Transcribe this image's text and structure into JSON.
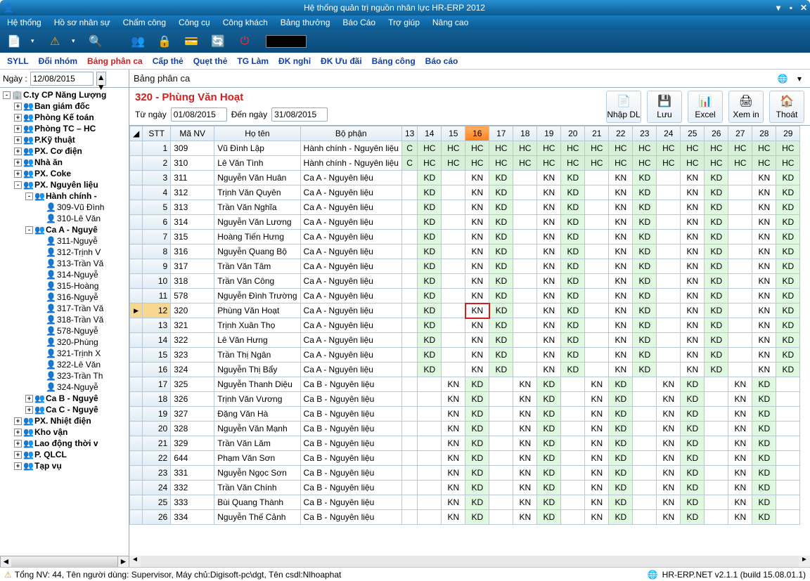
{
  "window": {
    "title": "Hệ thống quản trị nguồn nhân lực HR-ERP 2012"
  },
  "menu": [
    "Hệ thống",
    "Hồ sơ nhân sự",
    "Chấm công",
    "Công cụ",
    "Công khách",
    "Bảng thưởng",
    "Báo Cáo",
    "Trợ giúp",
    "Nâng cao"
  ],
  "tabs": [
    "SYLL",
    "Đổi nhóm",
    "Bảng phân ca",
    "Cấp thẻ",
    "Quẹt thẻ",
    "TG Làm",
    "ĐK nghỉ",
    "ĐK Ưu đãi",
    "Bảng công",
    "Báo cáo"
  ],
  "tabs_active_index": 2,
  "left": {
    "date_label": "Ngày :",
    "date_value": "12/08/2015",
    "tree": [
      {
        "ind": 0,
        "exp": "-",
        "bold": true,
        "ico": "🏢",
        "label": "C.ty CP Năng Lượng"
      },
      {
        "ind": 1,
        "exp": "+",
        "bold": true,
        "ico": "👥",
        "label": "Ban giám đốc"
      },
      {
        "ind": 1,
        "exp": "+",
        "bold": true,
        "ico": "👥",
        "label": "Phòng Kế toán"
      },
      {
        "ind": 1,
        "exp": "+",
        "bold": true,
        "ico": "👥",
        "label": "Phòng TC – HC"
      },
      {
        "ind": 1,
        "exp": "+",
        "bold": true,
        "ico": "👥",
        "label": "P.Kỹ thuật"
      },
      {
        "ind": 1,
        "exp": "+",
        "bold": true,
        "ico": "👥",
        "label": "PX. Cơ điện"
      },
      {
        "ind": 1,
        "exp": "+",
        "bold": true,
        "ico": "👥",
        "label": "Nhà ăn"
      },
      {
        "ind": 1,
        "exp": "+",
        "bold": true,
        "ico": "👥",
        "label": "PX. Coke"
      },
      {
        "ind": 1,
        "exp": "-",
        "bold": true,
        "ico": "👥",
        "label": "PX. Nguyên liệu"
      },
      {
        "ind": 2,
        "exp": "-",
        "bold": true,
        "ico": "👥",
        "label": "Hành chính -"
      },
      {
        "ind": 3,
        "exp": "",
        "bold": false,
        "ico": "👤",
        "label": "309-Vũ Đình"
      },
      {
        "ind": 3,
        "exp": "",
        "bold": false,
        "ico": "👤",
        "label": "310-Lê Văn"
      },
      {
        "ind": 2,
        "exp": "-",
        "bold": true,
        "ico": "👥",
        "label": "Ca A - Nguyê"
      },
      {
        "ind": 3,
        "exp": "",
        "bold": false,
        "ico": "👤",
        "label": "311-Nguyễ"
      },
      {
        "ind": 3,
        "exp": "",
        "bold": false,
        "ico": "👤",
        "label": "312-Trịnh V"
      },
      {
        "ind": 3,
        "exp": "",
        "bold": false,
        "ico": "👤",
        "label": "313-Trần Vă"
      },
      {
        "ind": 3,
        "exp": "",
        "bold": false,
        "ico": "👤",
        "label": "314-Nguyễ"
      },
      {
        "ind": 3,
        "exp": "",
        "bold": false,
        "ico": "👤",
        "label": "315-Hoàng"
      },
      {
        "ind": 3,
        "exp": "",
        "bold": false,
        "ico": "👤",
        "label": "316-Nguyễ"
      },
      {
        "ind": 3,
        "exp": "",
        "bold": false,
        "ico": "👤",
        "label": "317-Trần Vă"
      },
      {
        "ind": 3,
        "exp": "",
        "bold": false,
        "ico": "👤",
        "label": "318-Trần Vă"
      },
      {
        "ind": 3,
        "exp": "",
        "bold": false,
        "ico": "👤",
        "label": "578-Nguyễ"
      },
      {
        "ind": 3,
        "exp": "",
        "bold": false,
        "ico": "👤",
        "label": "320-Phùng"
      },
      {
        "ind": 3,
        "exp": "",
        "bold": false,
        "ico": "👤",
        "label": "321-Trịnh X"
      },
      {
        "ind": 3,
        "exp": "",
        "bold": false,
        "ico": "👤",
        "label": "322-Lê Văn"
      },
      {
        "ind": 3,
        "exp": "",
        "bold": false,
        "ico": "👤",
        "label": "323-Trần Th"
      },
      {
        "ind": 3,
        "exp": "",
        "bold": false,
        "ico": "👤",
        "label": "324-Nguyễ"
      },
      {
        "ind": 2,
        "exp": "+",
        "bold": true,
        "ico": "👥",
        "label": "Ca B - Nguyê"
      },
      {
        "ind": 2,
        "exp": "+",
        "bold": true,
        "ico": "👥",
        "label": "Ca C - Nguyê"
      },
      {
        "ind": 1,
        "exp": "+",
        "bold": true,
        "ico": "👥",
        "label": "PX. Nhiệt điện"
      },
      {
        "ind": 1,
        "exp": "+",
        "bold": true,
        "ico": "👥",
        "label": "Kho vận"
      },
      {
        "ind": 1,
        "exp": "+",
        "bold": true,
        "ico": "👥",
        "label": "Lao động thời v"
      },
      {
        "ind": 1,
        "exp": "+",
        "bold": true,
        "ico": "👥",
        "label": "P. QLCL"
      },
      {
        "ind": 1,
        "exp": "+",
        "bold": true,
        "ico": "👥",
        "label": "Tạp vụ"
      }
    ]
  },
  "content": {
    "title": "Bảng phân ca",
    "selected": "320 - Phùng Văn Hoạt",
    "from_label": "Từ ngày",
    "from_value": "01/08/2015",
    "to_label": "Đến ngày",
    "to_value": "31/08/2015",
    "buttons": [
      {
        "ico": "📄",
        "label": "Nhập DL"
      },
      {
        "ico": "💾",
        "label": "Lưu"
      },
      {
        "ico": "📊",
        "label": "Excel"
      },
      {
        "ico": "🖨",
        "label": "Xem in"
      },
      {
        "ico": "🏠",
        "label": "Thoát"
      }
    ],
    "columns": [
      "",
      "STT",
      "Mã NV",
      "Họ tên",
      "Bộ phận",
      "13",
      "14",
      "15",
      "16",
      "17",
      "18",
      "19",
      "20",
      "21",
      "22",
      "23",
      "24",
      "25",
      "26",
      "27",
      "28",
      "29"
    ],
    "selected_day_col": 8,
    "selected_row": 11,
    "rows": [
      {
        "stt": 1,
        "ma": "309",
        "ten": "Vũ Đình Lập",
        "bp": "Hành chính - Nguyên liệu",
        "s": [
          "C",
          "HC",
          "HC",
          "HC",
          "HC",
          "HC",
          "HC",
          "HC",
          "HC",
          "HC",
          "HC",
          "HC",
          "HC",
          "HC",
          "HC",
          "HC",
          "HC"
        ]
      },
      {
        "stt": 2,
        "ma": "310",
        "ten": "Lê Văn Tình",
        "bp": "Hành chính - Nguyên liệu",
        "s": [
          "C",
          "HC",
          "HC",
          "HC",
          "HC",
          "HC",
          "HC",
          "HC",
          "HC",
          "HC",
          "HC",
          "HC",
          "HC",
          "HC",
          "HC",
          "HC",
          "HC"
        ]
      },
      {
        "stt": 3,
        "ma": "311",
        "ten": "Nguyễn Văn Huân",
        "bp": "Ca A - Nguyên liệu",
        "s": [
          "",
          "KD",
          "",
          "KN",
          "KD",
          "",
          "KN",
          "KD",
          "",
          "KN",
          "KD",
          "",
          "KN",
          "KD",
          "",
          "KN",
          "KD"
        ]
      },
      {
        "stt": 4,
        "ma": "312",
        "ten": "Trịnh Văn Quyên",
        "bp": "Ca A - Nguyên liệu",
        "s": [
          "",
          "KD",
          "",
          "KN",
          "KD",
          "",
          "KN",
          "KD",
          "",
          "KN",
          "KD",
          "",
          "KN",
          "KD",
          "",
          "KN",
          "KD"
        ]
      },
      {
        "stt": 5,
        "ma": "313",
        "ten": "Trần Văn Nghĩa",
        "bp": "Ca A - Nguyên liệu",
        "s": [
          "",
          "KD",
          "",
          "KN",
          "KD",
          "",
          "KN",
          "KD",
          "",
          "KN",
          "KD",
          "",
          "KN",
          "KD",
          "",
          "KN",
          "KD"
        ]
      },
      {
        "stt": 6,
        "ma": "314",
        "ten": "Nguyễn Văn Lương",
        "bp": "Ca A - Nguyên liệu",
        "s": [
          "",
          "KD",
          "",
          "KN",
          "KD",
          "",
          "KN",
          "KD",
          "",
          "KN",
          "KD",
          "",
          "KN",
          "KD",
          "",
          "KN",
          "KD"
        ]
      },
      {
        "stt": 7,
        "ma": "315",
        "ten": "Hoàng Tiến Hưng",
        "bp": "Ca A - Nguyên liệu",
        "s": [
          "",
          "KD",
          "",
          "KN",
          "KD",
          "",
          "KN",
          "KD",
          "",
          "KN",
          "KD",
          "",
          "KN",
          "KD",
          "",
          "KN",
          "KD"
        ]
      },
      {
        "stt": 8,
        "ma": "316",
        "ten": "Nguyễn Quang Bộ",
        "bp": "Ca A - Nguyên liệu",
        "s": [
          "",
          "KD",
          "",
          "KN",
          "KD",
          "",
          "KN",
          "KD",
          "",
          "KN",
          "KD",
          "",
          "KN",
          "KD",
          "",
          "KN",
          "KD"
        ]
      },
      {
        "stt": 9,
        "ma": "317",
        "ten": "Trần Văn Tâm",
        "bp": "Ca A - Nguyên liệu",
        "s": [
          "",
          "KD",
          "",
          "KN",
          "KD",
          "",
          "KN",
          "KD",
          "",
          "KN",
          "KD",
          "",
          "KN",
          "KD",
          "",
          "KN",
          "KD"
        ]
      },
      {
        "stt": 10,
        "ma": "318",
        "ten": "Trần Văn Công",
        "bp": "Ca A - Nguyên liệu",
        "s": [
          "",
          "KD",
          "",
          "KN",
          "KD",
          "",
          "KN",
          "KD",
          "",
          "KN",
          "KD",
          "",
          "KN",
          "KD",
          "",
          "KN",
          "KD"
        ]
      },
      {
        "stt": 11,
        "ma": "578",
        "ten": "Nguyễn Đình Trường",
        "bp": "Ca A - Nguyên liệu",
        "s": [
          "",
          "KD",
          "",
          "KN",
          "KD",
          "",
          "KN",
          "KD",
          "",
          "KN",
          "KD",
          "",
          "KN",
          "KD",
          "",
          "KN",
          "KD"
        ]
      },
      {
        "stt": 12,
        "ma": "320",
        "ten": "Phùng Văn Hoạt",
        "bp": "Ca A - Nguyên liệu",
        "s": [
          "",
          "KD",
          "",
          "KN",
          "KD",
          "",
          "KN",
          "KD",
          "",
          "KN",
          "KD",
          "",
          "KN",
          "KD",
          "",
          "KN",
          "KD"
        ]
      },
      {
        "stt": 13,
        "ma": "321",
        "ten": "Trịnh Xuân Thọ",
        "bp": "Ca A - Nguyên liệu",
        "s": [
          "",
          "KD",
          "",
          "KN",
          "KD",
          "",
          "KN",
          "KD",
          "",
          "KN",
          "KD",
          "",
          "KN",
          "KD",
          "",
          "KN",
          "KD"
        ]
      },
      {
        "stt": 14,
        "ma": "322",
        "ten": "Lê Văn Hưng",
        "bp": "Ca A - Nguyên liệu",
        "s": [
          "",
          "KD",
          "",
          "KN",
          "KD",
          "",
          "KN",
          "KD",
          "",
          "KN",
          "KD",
          "",
          "KN",
          "KD",
          "",
          "KN",
          "KD"
        ]
      },
      {
        "stt": 15,
        "ma": "323",
        "ten": "Trần Thị Ngân",
        "bp": "Ca A - Nguyên liệu",
        "s": [
          "",
          "KD",
          "",
          "KN",
          "KD",
          "",
          "KN",
          "KD",
          "",
          "KN",
          "KD",
          "",
          "KN",
          "KD",
          "",
          "KN",
          "KD"
        ]
      },
      {
        "stt": 16,
        "ma": "324",
        "ten": "Nguyễn Thị Bẩy",
        "bp": "Ca A - Nguyên liệu",
        "s": [
          "",
          "KD",
          "",
          "KN",
          "KD",
          "",
          "KN",
          "KD",
          "",
          "KN",
          "KD",
          "",
          "KN",
          "KD",
          "",
          "KN",
          "KD"
        ]
      },
      {
        "stt": 17,
        "ma": "325",
        "ten": "Nguyễn Thanh Diệu",
        "bp": "Ca B - Nguyên liệu",
        "s": [
          "",
          "",
          "KN",
          "KD",
          "",
          "KN",
          "KD",
          "",
          "KN",
          "KD",
          "",
          "KN",
          "KD",
          "",
          "KN",
          "KD",
          ""
        ]
      },
      {
        "stt": 18,
        "ma": "326",
        "ten": "Trịnh Văn Vương",
        "bp": "Ca B - Nguyên liệu",
        "s": [
          "",
          "",
          "KN",
          "KD",
          "",
          "KN",
          "KD",
          "",
          "KN",
          "KD",
          "",
          "KN",
          "KD",
          "",
          "KN",
          "KD",
          ""
        ]
      },
      {
        "stt": 19,
        "ma": "327",
        "ten": "Đặng Văn Hà",
        "bp": "Ca B - Nguyên liệu",
        "s": [
          "",
          "",
          "KN",
          "KD",
          "",
          "KN",
          "KD",
          "",
          "KN",
          "KD",
          "",
          "KN",
          "KD",
          "",
          "KN",
          "KD",
          ""
        ]
      },
      {
        "stt": 20,
        "ma": "328",
        "ten": "Nguyễn Văn Mạnh",
        "bp": "Ca B - Nguyên liệu",
        "s": [
          "",
          "",
          "KN",
          "KD",
          "",
          "KN",
          "KD",
          "",
          "KN",
          "KD",
          "",
          "KN",
          "KD",
          "",
          "KN",
          "KD",
          ""
        ]
      },
      {
        "stt": 21,
        "ma": "329",
        "ten": "Trần Văn Lăm",
        "bp": "Ca B - Nguyên liệu",
        "s": [
          "",
          "",
          "KN",
          "KD",
          "",
          "KN",
          "KD",
          "",
          "KN",
          "KD",
          "",
          "KN",
          "KD",
          "",
          "KN",
          "KD",
          ""
        ]
      },
      {
        "stt": 22,
        "ma": "644",
        "ten": "Phạm Văn Sơn",
        "bp": "Ca B - Nguyên liệu",
        "s": [
          "",
          "",
          "KN",
          "KD",
          "",
          "KN",
          "KD",
          "",
          "KN",
          "KD",
          "",
          "KN",
          "KD",
          "",
          "KN",
          "KD",
          ""
        ]
      },
      {
        "stt": 23,
        "ma": "331",
        "ten": "Nguyễn Ngọc Sơn",
        "bp": "Ca B - Nguyên liệu",
        "s": [
          "",
          "",
          "KN",
          "KD",
          "",
          "KN",
          "KD",
          "",
          "KN",
          "KD",
          "",
          "KN",
          "KD",
          "",
          "KN",
          "KD",
          ""
        ]
      },
      {
        "stt": 24,
        "ma": "332",
        "ten": "Trần Văn Chính",
        "bp": "Ca B - Nguyên liệu",
        "s": [
          "",
          "",
          "KN",
          "KD",
          "",
          "KN",
          "KD",
          "",
          "KN",
          "KD",
          "",
          "KN",
          "KD",
          "",
          "KN",
          "KD",
          ""
        ]
      },
      {
        "stt": 25,
        "ma": "333",
        "ten": "Bùi Quang Thành",
        "bp": "Ca B - Nguyên liệu",
        "s": [
          "",
          "",
          "KN",
          "KD",
          "",
          "KN",
          "KD",
          "",
          "KN",
          "KD",
          "",
          "KN",
          "KD",
          "",
          "KN",
          "KD",
          ""
        ]
      },
      {
        "stt": 26,
        "ma": "334",
        "ten": "Nguyễn Thế Cảnh",
        "bp": "Ca B - Nguyên liệu",
        "s": [
          "",
          "",
          "KN",
          "KD",
          "",
          "KN",
          "KD",
          "",
          "KN",
          "KD",
          "",
          "KN",
          "KD",
          "",
          "KN",
          "KD",
          ""
        ]
      }
    ]
  },
  "status": {
    "text": "Tổng NV: 44, Tên người dùng: Supervisor, Máy chủ:Digisoft-pc\\dgt, Tên csdl:Nlhoaphat",
    "version": "HR-ERP.NET v2.1.1 (build 15.08.01.1)"
  }
}
